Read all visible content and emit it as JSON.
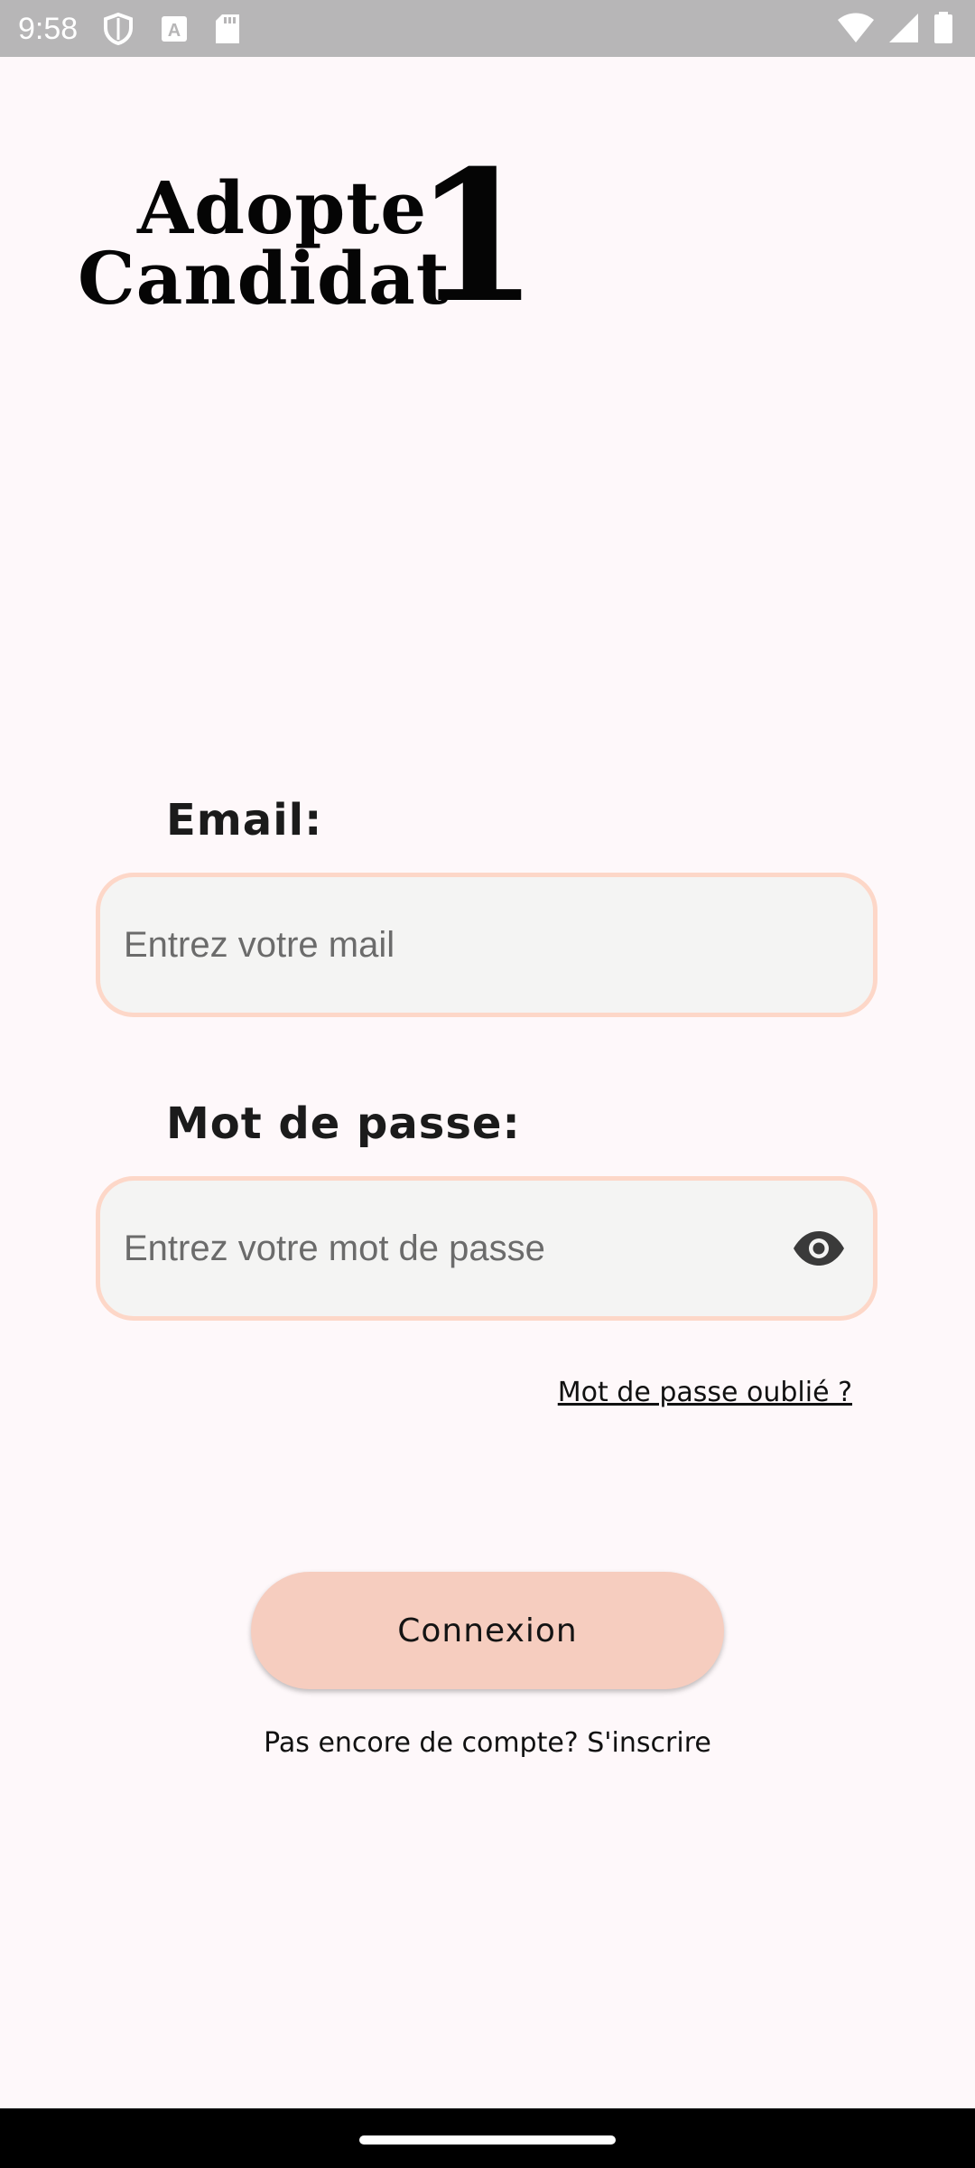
{
  "status_bar": {
    "time": "9:58",
    "left_icons": [
      "shield-icon",
      "text-a-icon",
      "sd-card-icon"
    ],
    "right_icons": [
      "wifi-icon",
      "signal-icon",
      "battery-icon"
    ]
  },
  "logo": {
    "line1": "Adopte",
    "line2": "Candidat",
    "number": "1"
  },
  "email": {
    "label": "Email:",
    "placeholder": "Entrez votre mail",
    "value": ""
  },
  "password": {
    "label": "Mot de passe:",
    "placeholder": "Entrez votre mot de passe",
    "value": "",
    "toggle_icon": "eye-icon"
  },
  "forgot_password": "Mot de passe oublié ?",
  "login_button": "Connexion",
  "signup_text": "Pas encore de compte? S'inscrire",
  "colors": {
    "background": "#fef8fa",
    "field_border": "#fdd7c8",
    "field_bg": "#f4f4f3",
    "button_bg": "#f6cdbf",
    "status_bar": "#b7b6b7"
  }
}
